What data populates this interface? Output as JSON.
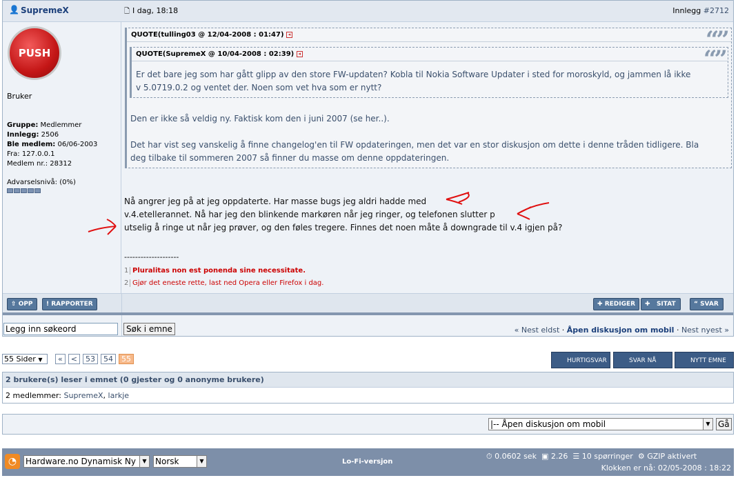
{
  "author": {
    "name": "SupremeX",
    "avatar_text": "PUSH",
    "role": "Bruker",
    "group_label": "Gruppe:",
    "group": "Medlemmer",
    "posts_label": "Innlegg:",
    "posts": "2506",
    "joined_label": "Ble medlem:",
    "joined": "06/06-2003",
    "from_label": "Fra:",
    "from": "127.0.0.1",
    "memberno_label": "Medlem nr.:",
    "memberno": "28312",
    "warn_label": "Advarselsnivå:",
    "warn": "(0%)"
  },
  "post": {
    "date": "I dag, 18:18",
    "post_label": "Innlegg",
    "post_no": "#2712",
    "quote1_header": "QUOTE(tulling03 @ 12/04-2008 : 01:47)",
    "quote2_header": "QUOTE(SupremeX @ 10/04-2008 : 02:39)",
    "quote2_line1": "Er det bare jeg som har gått glipp av den store FW-updaten? Kobla til Nokia Software Updater i sted for moroskyld, og jammen lå ikke",
    "quote2_line2": "v 5.0719.0.2 og ventet der. Noen som vet hva som er nytt?",
    "quote1_line1": "Den er ikke så veldig ny. Faktisk kom den i juni 2007 (se her..).",
    "quote1_line2": "Det har vist seg vanskelig å finne changelog'en til FW opdateringen, men det var en stor diskusjon om dette i denne tråden tidligere. Bla",
    "quote1_line3": "deg tilbake til sommeren 2007 så finner du masse om denne oppdateringen.",
    "body_line1": "Nå angrer jeg på at jeg oppdaterte. Har masse bugs jeg aldri hadde med",
    "body_line2": "v.4.etellerannet. Nå har jeg den blinkende markøren når jeg ringer, og telefonen slutter p",
    "body_line3": "utselig å ringe ut når jeg prøver, og den føles tregere. Finnes det noen måte å downgrade til v.4 igjen på?",
    "sig_sep": "--------------------",
    "sig1": "Pluralitas non est ponenda sine necessitate.",
    "sig2": "Gjør det eneste rette, last ned Opera eller Firefox i dag."
  },
  "buttons": {
    "top": "OPP",
    "report": "RAPPORTER",
    "edit": "REDIGER",
    "quote": "SITAT",
    "reply": "SVAR"
  },
  "search": {
    "placeholder_value": "Legg inn søkeord",
    "button": "Søk i emne"
  },
  "topicnav": {
    "prev": "« Nest eldst",
    "sep": "·",
    "current": "Åpen diskusjon om mobil",
    "next": "Nest nyest »"
  },
  "pagination": {
    "pages_label": "55 Sider",
    "first": "«",
    "prev": "<",
    "p1": "53",
    "p2": "54",
    "p3": "55"
  },
  "actions": {
    "quick": "HURTIGSVAR",
    "reply_now": "SVAR NÅ",
    "new_topic": "NYTT EMNE"
  },
  "readers": {
    "title": "2 brukere(s) leser i emnet (0 gjester og 0 anonyme brukere)",
    "label": "2 medlemmer:",
    "u1": "SupremeX",
    "u2": "larkje"
  },
  "jump": {
    "selected": "|-- Åpen diskusjon om mobil",
    "go": "Gå"
  },
  "footer": {
    "skin": "Hardware.no Dynamisk Ny",
    "lang": "Norsk",
    "lofi": "Lo-Fi-versjon",
    "time": "0.0602 sek",
    "load": "2.26",
    "queries": "10 spørringer",
    "gzip": "GZIP aktivert",
    "clock": "Klokken er nå: 02/05-2008 : 18:22"
  },
  "colors": {
    "accent": "#3a4f6c",
    "sig": "#cc0000",
    "push": "#d32020",
    "footer_bg": "#7d8fa9"
  }
}
